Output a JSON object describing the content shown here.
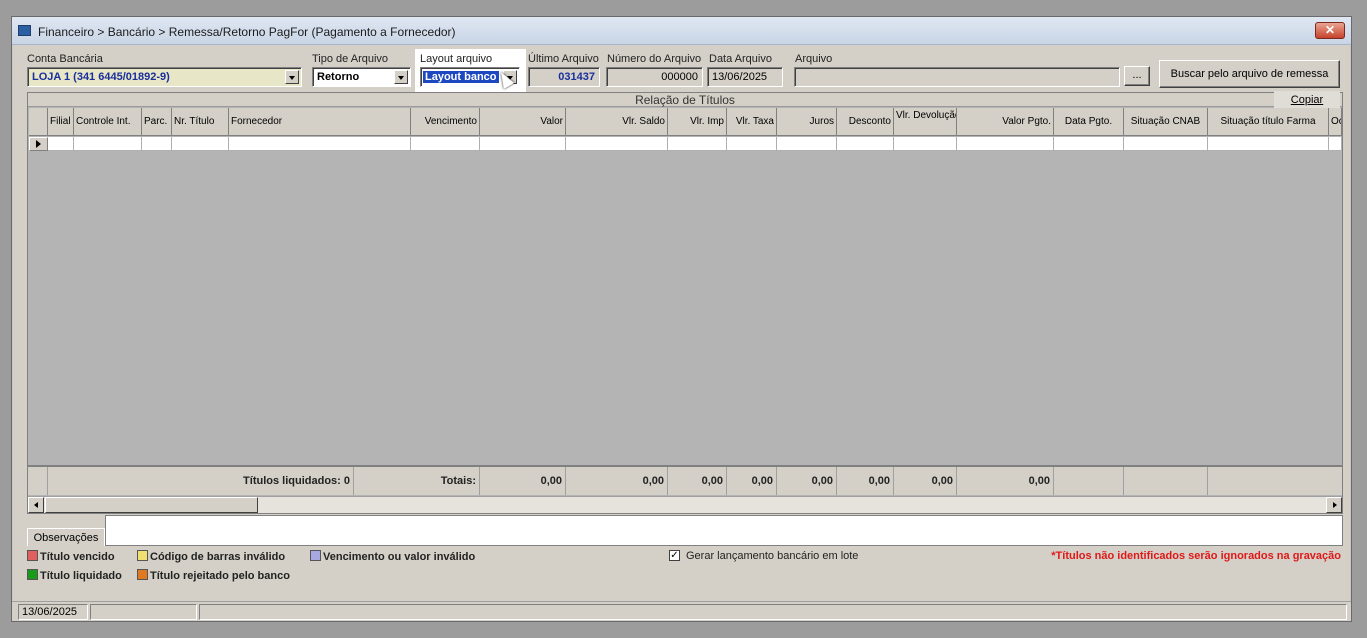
{
  "window": {
    "title": "Financeiro > Bancário > Remessa/Retorno PagFor (Pagamento  a Fornecedor)",
    "close_label": "✕"
  },
  "form": {
    "conta_bancaria": {
      "label": "Conta Bancária",
      "value": "LOJA 1 (341 6445/01892-9)"
    },
    "tipo_arquivo": {
      "label": "Tipo de Arquivo",
      "value": "Retorno"
    },
    "layout_arquivo": {
      "label": "Layout arquivo",
      "value": "Layout banco"
    },
    "ultimo_arquivo": {
      "label": "Último Arquivo",
      "value": "031437"
    },
    "numero_arquivo": {
      "label": "Número do Arquivo",
      "value": "000000"
    },
    "data_arquivo": {
      "label": "Data Arquivo",
      "value": "13/06/2025"
    },
    "arquivo": {
      "label": "Arquivo",
      "value": "",
      "browse_label": "..."
    },
    "buscar_button": "Buscar pelo arquivo de remessa"
  },
  "grid": {
    "caption": "Relação de Títulos",
    "copy_label": "Copiar",
    "columns": [
      "Filial",
      "Controle Int.",
      "Parc.",
      "Nr. Título",
      "Fornecedor",
      "Vencimento",
      "Valor",
      "Vlr. Saldo",
      "Vlr. Imp",
      "Vlr. Taxa",
      "Juros",
      "Desconto",
      "Vlr. Devolução",
      "Valor Pgto.",
      "Data Pgto.",
      "Situação CNAB",
      "Situação título Farma",
      "Oc"
    ],
    "footer": {
      "liquidados": "Títulos liquidados: 0",
      "totais": "Totais:",
      "valor": "0,00",
      "saldo": "0,00",
      "imp": "0,00",
      "taxa": "0,00",
      "juros": "0,00",
      "desconto": "0,00",
      "devolucao": "0,00",
      "valor_pgto": "0,00"
    }
  },
  "observacoes": {
    "tab_label": "Observações",
    "value": ""
  },
  "legend": {
    "items": [
      {
        "label": "Título vencido",
        "color": "#e06060"
      },
      {
        "label": "Código de barras inválido",
        "color": "#f0e070"
      },
      {
        "label": "Vencimento ou valor inválido",
        "color": "#a8a8e0"
      },
      {
        "label": "Título liquidado",
        "color": "#1a9a1a"
      },
      {
        "label": "Título rejeitado pelo banco",
        "color": "#e07a20"
      }
    ]
  },
  "options": {
    "gerar_lote": {
      "label": "Gerar lançamento bancário em lote",
      "checked": true
    }
  },
  "warning": "*Títulos não identificados serão ignorados na gravação",
  "status": {
    "date": "13/06/2025",
    "panel2": "",
    "panel3": ""
  }
}
